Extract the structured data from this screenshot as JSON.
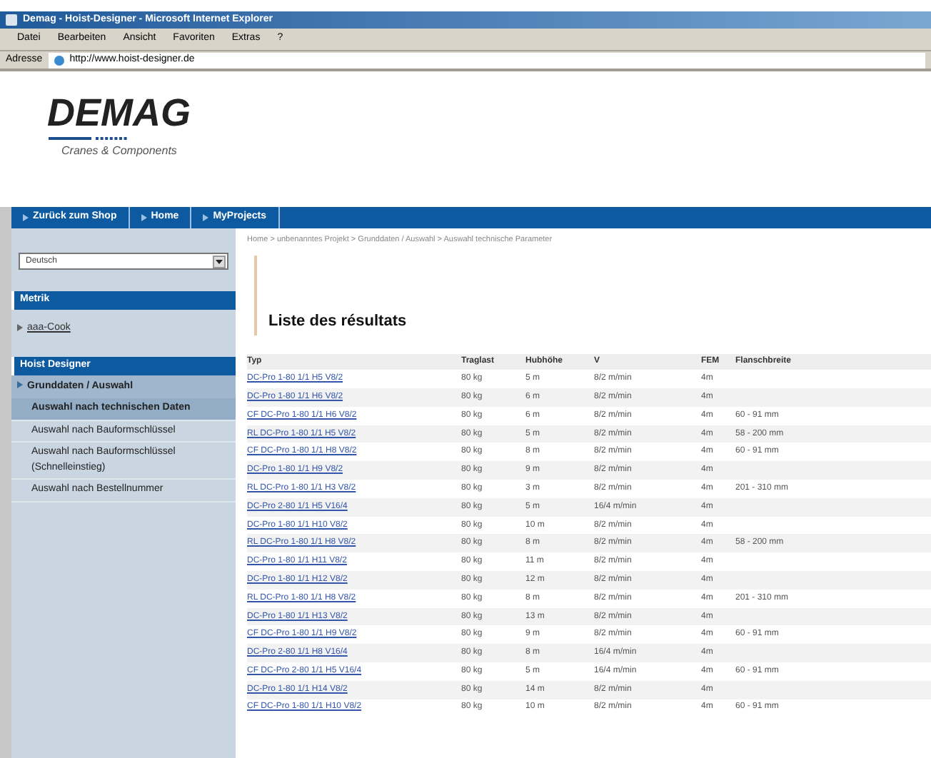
{
  "window": {
    "title": "Demag - Hoist-Designer - Microsoft Internet Explorer"
  },
  "menu": [
    "Datei",
    "Bearbeiten",
    "Ansicht",
    "Favoriten",
    "Extras",
    "?"
  ],
  "address": {
    "label": "Adresse",
    "value": "http://www.hoist-designer.de"
  },
  "logo": {
    "name": "DEMAG",
    "tagline": "Cranes & Components"
  },
  "nav": [
    "Zurück zum Shop",
    "Home",
    "MyProjects"
  ],
  "sidebar": {
    "language": "Deutsch",
    "sections": [
      {
        "title": "Metrik",
        "items": [
          {
            "label": "aaa-Cook",
            "kind": "link",
            "selected": false
          }
        ]
      },
      {
        "title": "Hoist Designer",
        "items": [
          {
            "label": "Grunddaten / Auswahl",
            "kind": "group",
            "selected": false
          },
          {
            "label": "Auswahl nach technischen Daten",
            "kind": "sub",
            "selected": true
          },
          {
            "label": "Auswahl nach Bauformschlüssel",
            "kind": "sub",
            "selected": false
          },
          {
            "label": "Auswahl nach Bauformschlüssel (Schnelleinstieg)",
            "kind": "sub",
            "selected": false
          },
          {
            "label": "Auswahl nach Bestellnummer",
            "kind": "sub",
            "selected": false
          }
        ]
      }
    ]
  },
  "breadcrumb": "Home > unbenanntes Projekt > Grunddaten / Auswahl > Auswahl technische Parameter",
  "heading": "Liste des résultats",
  "table": {
    "columns": [
      "Typ",
      "Traglast",
      "Hubhöhe",
      "V",
      "FEM",
      "Flanschbreite"
    ],
    "rows": [
      [
        "DC-Pro 1-80 1/1 H5 V8/2",
        "80 kg",
        "5 m",
        "8/2 m/min",
        "4m",
        ""
      ],
      [
        "DC-Pro 1-80 1/1 H6 V8/2",
        "80 kg",
        "6 m",
        "8/2 m/min",
        "4m",
        ""
      ],
      [
        "CF DC-Pro 1-80 1/1 H6 V8/2",
        "80 kg",
        "6 m",
        "8/2 m/min",
        "4m",
        "60 - 91 mm"
      ],
      [
        "RL DC-Pro 1-80 1/1 H5 V8/2",
        "80 kg",
        "5 m",
        "8/2 m/min",
        "4m",
        "58 - 200 mm"
      ],
      [
        "CF DC-Pro 1-80 1/1 H8 V8/2",
        "80 kg",
        "8 m",
        "8/2 m/min",
        "4m",
        "60 - 91 mm"
      ],
      [
        "DC-Pro 1-80 1/1 H9 V8/2",
        "80 kg",
        "9 m",
        "8/2 m/min",
        "4m",
        ""
      ],
      [
        "RL DC-Pro 1-80 1/1 H3 V8/2",
        "80 kg",
        "3 m",
        "8/2 m/min",
        "4m",
        "201 - 310 mm"
      ],
      [
        "DC-Pro 2-80 1/1 H5 V16/4",
        "80 kg",
        "5 m",
        "16/4 m/min",
        "4m",
        ""
      ],
      [
        "DC-Pro 1-80 1/1 H10 V8/2",
        "80 kg",
        "10 m",
        "8/2 m/min",
        "4m",
        ""
      ],
      [
        "RL DC-Pro 1-80 1/1 H8 V8/2",
        "80 kg",
        "8 m",
        "8/2 m/min",
        "4m",
        "58 - 200 mm"
      ],
      [
        "DC-Pro 1-80 1/1 H11 V8/2",
        "80 kg",
        "11 m",
        "8/2 m/min",
        "4m",
        ""
      ],
      [
        "DC-Pro 1-80 1/1 H12 V8/2",
        "80 kg",
        "12 m",
        "8/2 m/min",
        "4m",
        ""
      ],
      [
        "RL DC-Pro 1-80 1/1 H8 V8/2",
        "80 kg",
        "8 m",
        "8/2 m/min",
        "4m",
        "201 - 310 mm"
      ],
      [
        "DC-Pro 1-80 1/1 H13 V8/2",
        "80 kg",
        "13 m",
        "8/2 m/min",
        "4m",
        ""
      ],
      [
        "CF DC-Pro 1-80 1/1 H9 V8/2",
        "80 kg",
        "9 m",
        "8/2 m/min",
        "4m",
        "60 - 91 mm"
      ],
      [
        "DC-Pro 2-80 1/1 H8 V16/4",
        "80 kg",
        "8 m",
        "16/4 m/min",
        "4m",
        ""
      ],
      [
        "CF DC-Pro 2-80 1/1 H5 V16/4",
        "80 kg",
        "5 m",
        "16/4 m/min",
        "4m",
        "60 - 91 mm"
      ],
      [
        "DC-Pro 1-80 1/1 H14 V8/2",
        "80 kg",
        "14 m",
        "8/2 m/min",
        "4m",
        ""
      ],
      [
        "CF DC-Pro 1-80 1/1 H10 V8/2",
        "80 kg",
        "10 m",
        "8/2 m/min",
        "4m",
        "60 - 91 mm"
      ]
    ]
  }
}
